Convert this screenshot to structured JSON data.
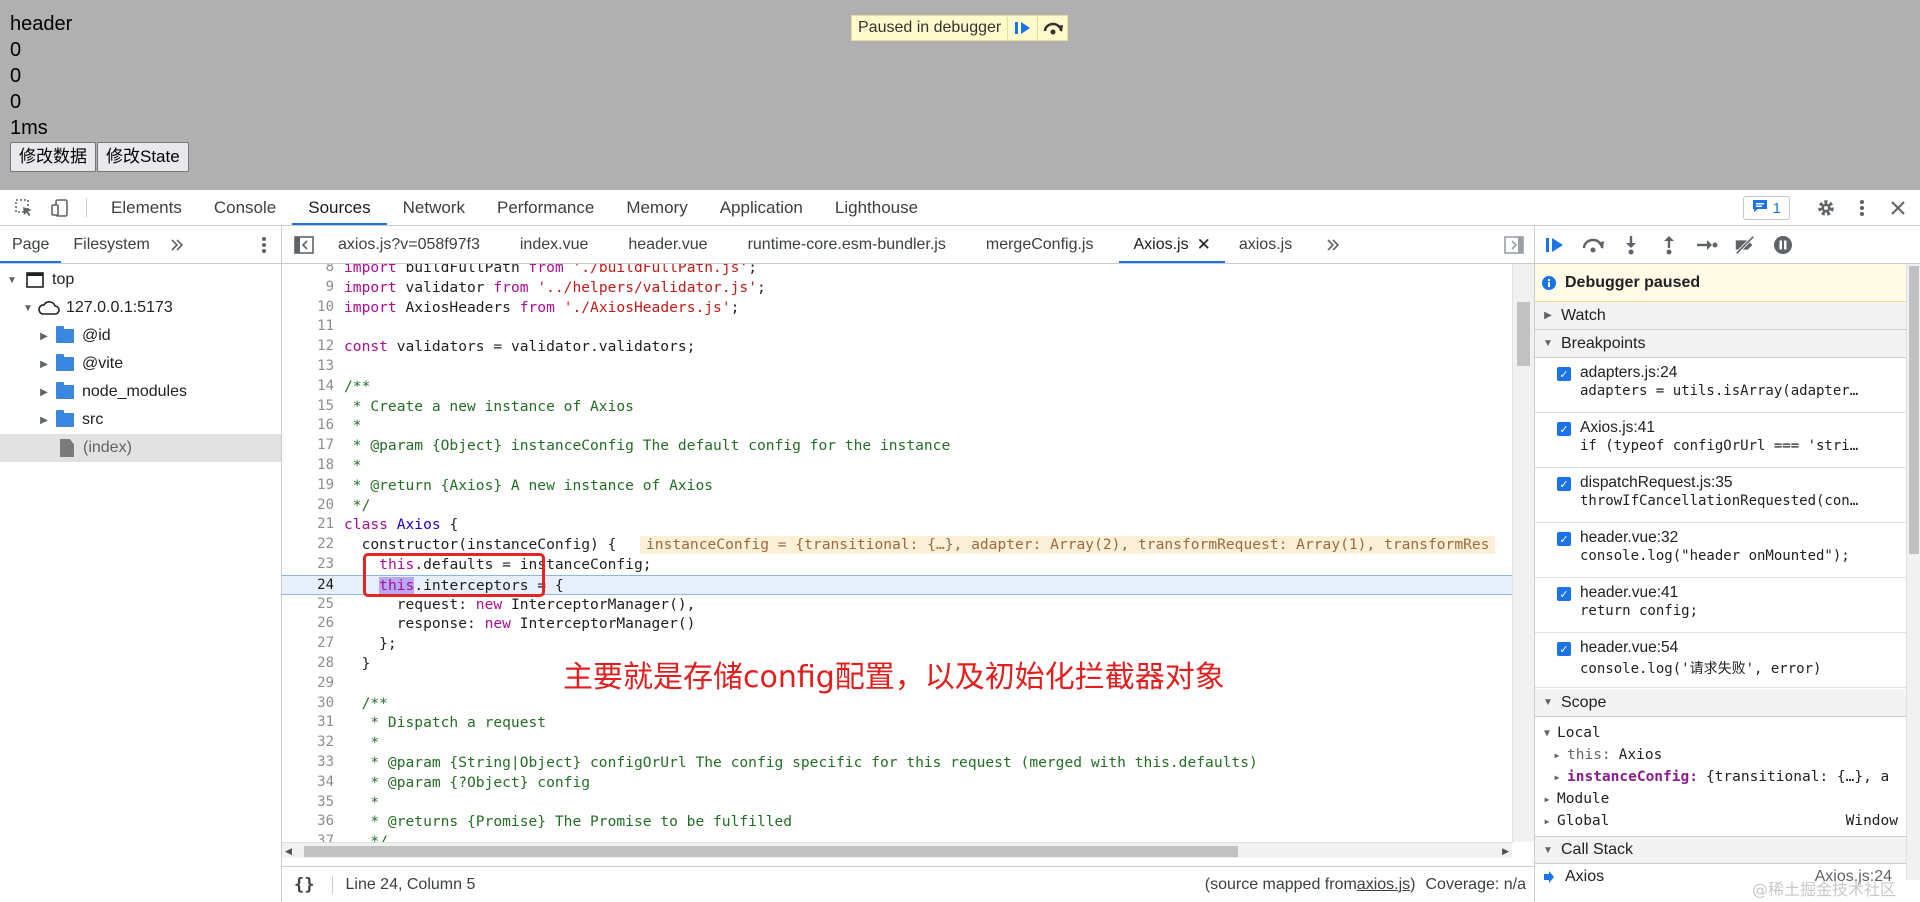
{
  "page": {
    "lines": [
      "header",
      "0",
      "0",
      "0",
      "1ms"
    ],
    "buttons": [
      "修改数据",
      "修改State"
    ],
    "paused_overlay": "Paused in debugger"
  },
  "devtools": {
    "tabs": [
      "Elements",
      "Console",
      "Sources",
      "Network",
      "Performance",
      "Memory",
      "Application",
      "Lighthouse"
    ],
    "active_tab": "Sources",
    "issues_count": "1"
  },
  "navigator": {
    "tabs": [
      "Page",
      "Filesystem"
    ],
    "active_tab": "Page",
    "tree": {
      "top": "top",
      "host": "127.0.0.1:5173",
      "folders": [
        "@id",
        "@vite",
        "node_modules",
        "src"
      ],
      "file": "(index)"
    }
  },
  "editor": {
    "tabs": [
      "axios.js?v=058f97f3",
      "index.vue",
      "header.vue",
      "runtime-core.esm-bundler.js",
      "mergeConfig.js",
      "Axios.js",
      "axios.js"
    ],
    "active_tab": "Axios.js",
    "inline_value": "instanceConfig = {transitional: {…}, adapter: Array(2), transformRequest: Array(1), transformRes",
    "annotation": "主要就是存储config配置，以及初始化拦截器对象",
    "status": {
      "position": "Line 24, Column 5",
      "source_mapped_prefix": "(source mapped from ",
      "source_mapped_file": "axios.js",
      "source_mapped_suffix": ")",
      "coverage": "Coverage: n/a"
    }
  },
  "code": [
    {
      "n": "8",
      "t": "import buildFullPath from './buildFullPath.js';"
    },
    {
      "n": "9",
      "t": "import validator from '../helpers/validator.js';"
    },
    {
      "n": "10",
      "t": "import AxiosHeaders from './AxiosHeaders.js';"
    },
    {
      "n": "11",
      "t": ""
    },
    {
      "n": "12",
      "t": "const validators = validator.validators;"
    },
    {
      "n": "13",
      "t": ""
    },
    {
      "n": "14",
      "t": "/**"
    },
    {
      "n": "15",
      "t": " * Create a new instance of Axios"
    },
    {
      "n": "16",
      "t": " *"
    },
    {
      "n": "17",
      "t": " * @param {Object} instanceConfig The default config for the instance"
    },
    {
      "n": "18",
      "t": " *"
    },
    {
      "n": "19",
      "t": " * @return {Axios} A new instance of Axios"
    },
    {
      "n": "20",
      "t": " */"
    },
    {
      "n": "21",
      "t": "class Axios {"
    },
    {
      "n": "22",
      "t": "  constructor(instanceConfig) {"
    },
    {
      "n": "23",
      "t": "    this.defaults = instanceConfig;"
    },
    {
      "n": "24",
      "t": "    this.interceptors = {"
    },
    {
      "n": "25",
      "t": "      request: new InterceptorManager(),"
    },
    {
      "n": "26",
      "t": "      response: new InterceptorManager()"
    },
    {
      "n": "27",
      "t": "    };"
    },
    {
      "n": "28",
      "t": "  }"
    },
    {
      "n": "29",
      "t": ""
    },
    {
      "n": "30",
      "t": "  /**"
    },
    {
      "n": "31",
      "t": "   * Dispatch a request"
    },
    {
      "n": "32",
      "t": "   *"
    },
    {
      "n": "33",
      "t": "   * @param {String|Object} configOrUrl The config specific for this request (merged with this.defaults)"
    },
    {
      "n": "34",
      "t": "   * @param {?Object} config"
    },
    {
      "n": "35",
      "t": "   *"
    },
    {
      "n": "36",
      "t": "   * @returns {Promise} The Promise to be fulfilled"
    },
    {
      "n": "37",
      "t": "   */"
    }
  ],
  "debugger": {
    "paused_message": "Debugger paused",
    "sections": {
      "watch": "Watch",
      "breakpoints": "Breakpoints",
      "scope": "Scope",
      "call_stack": "Call Stack"
    },
    "breakpoints": [
      {
        "location": "adapters.js:24",
        "code": "adapters = utils.isArray(adapter…"
      },
      {
        "location": "Axios.js:41",
        "code": "if (typeof configOrUrl === 'stri…"
      },
      {
        "location": "dispatchRequest.js:35",
        "code": "throwIfCancellationRequested(con…"
      },
      {
        "location": "header.vue:32",
        "code": "console.log(\"header onMounted\");"
      },
      {
        "location": "header.vue:41",
        "code": "return config;"
      },
      {
        "location": "header.vue:54",
        "code": "console.log('请求失败', error)"
      }
    ],
    "scope": {
      "local": "Local",
      "this_key": "this:",
      "this_val": "Axios",
      "ic_key": "instanceConfig:",
      "ic_val": "{transitional: {…}, a",
      "module": "Module",
      "global": "Global",
      "global_val": "Window"
    },
    "call_stack": {
      "fn": "Axios",
      "loc": "Axios.js:24"
    }
  },
  "watermark": "@稀土掘金技术社区",
  "colors": {
    "accent": "#1a73e8",
    "annotation_red": "#e31e1e",
    "paused_bg": "#fffbe6"
  }
}
